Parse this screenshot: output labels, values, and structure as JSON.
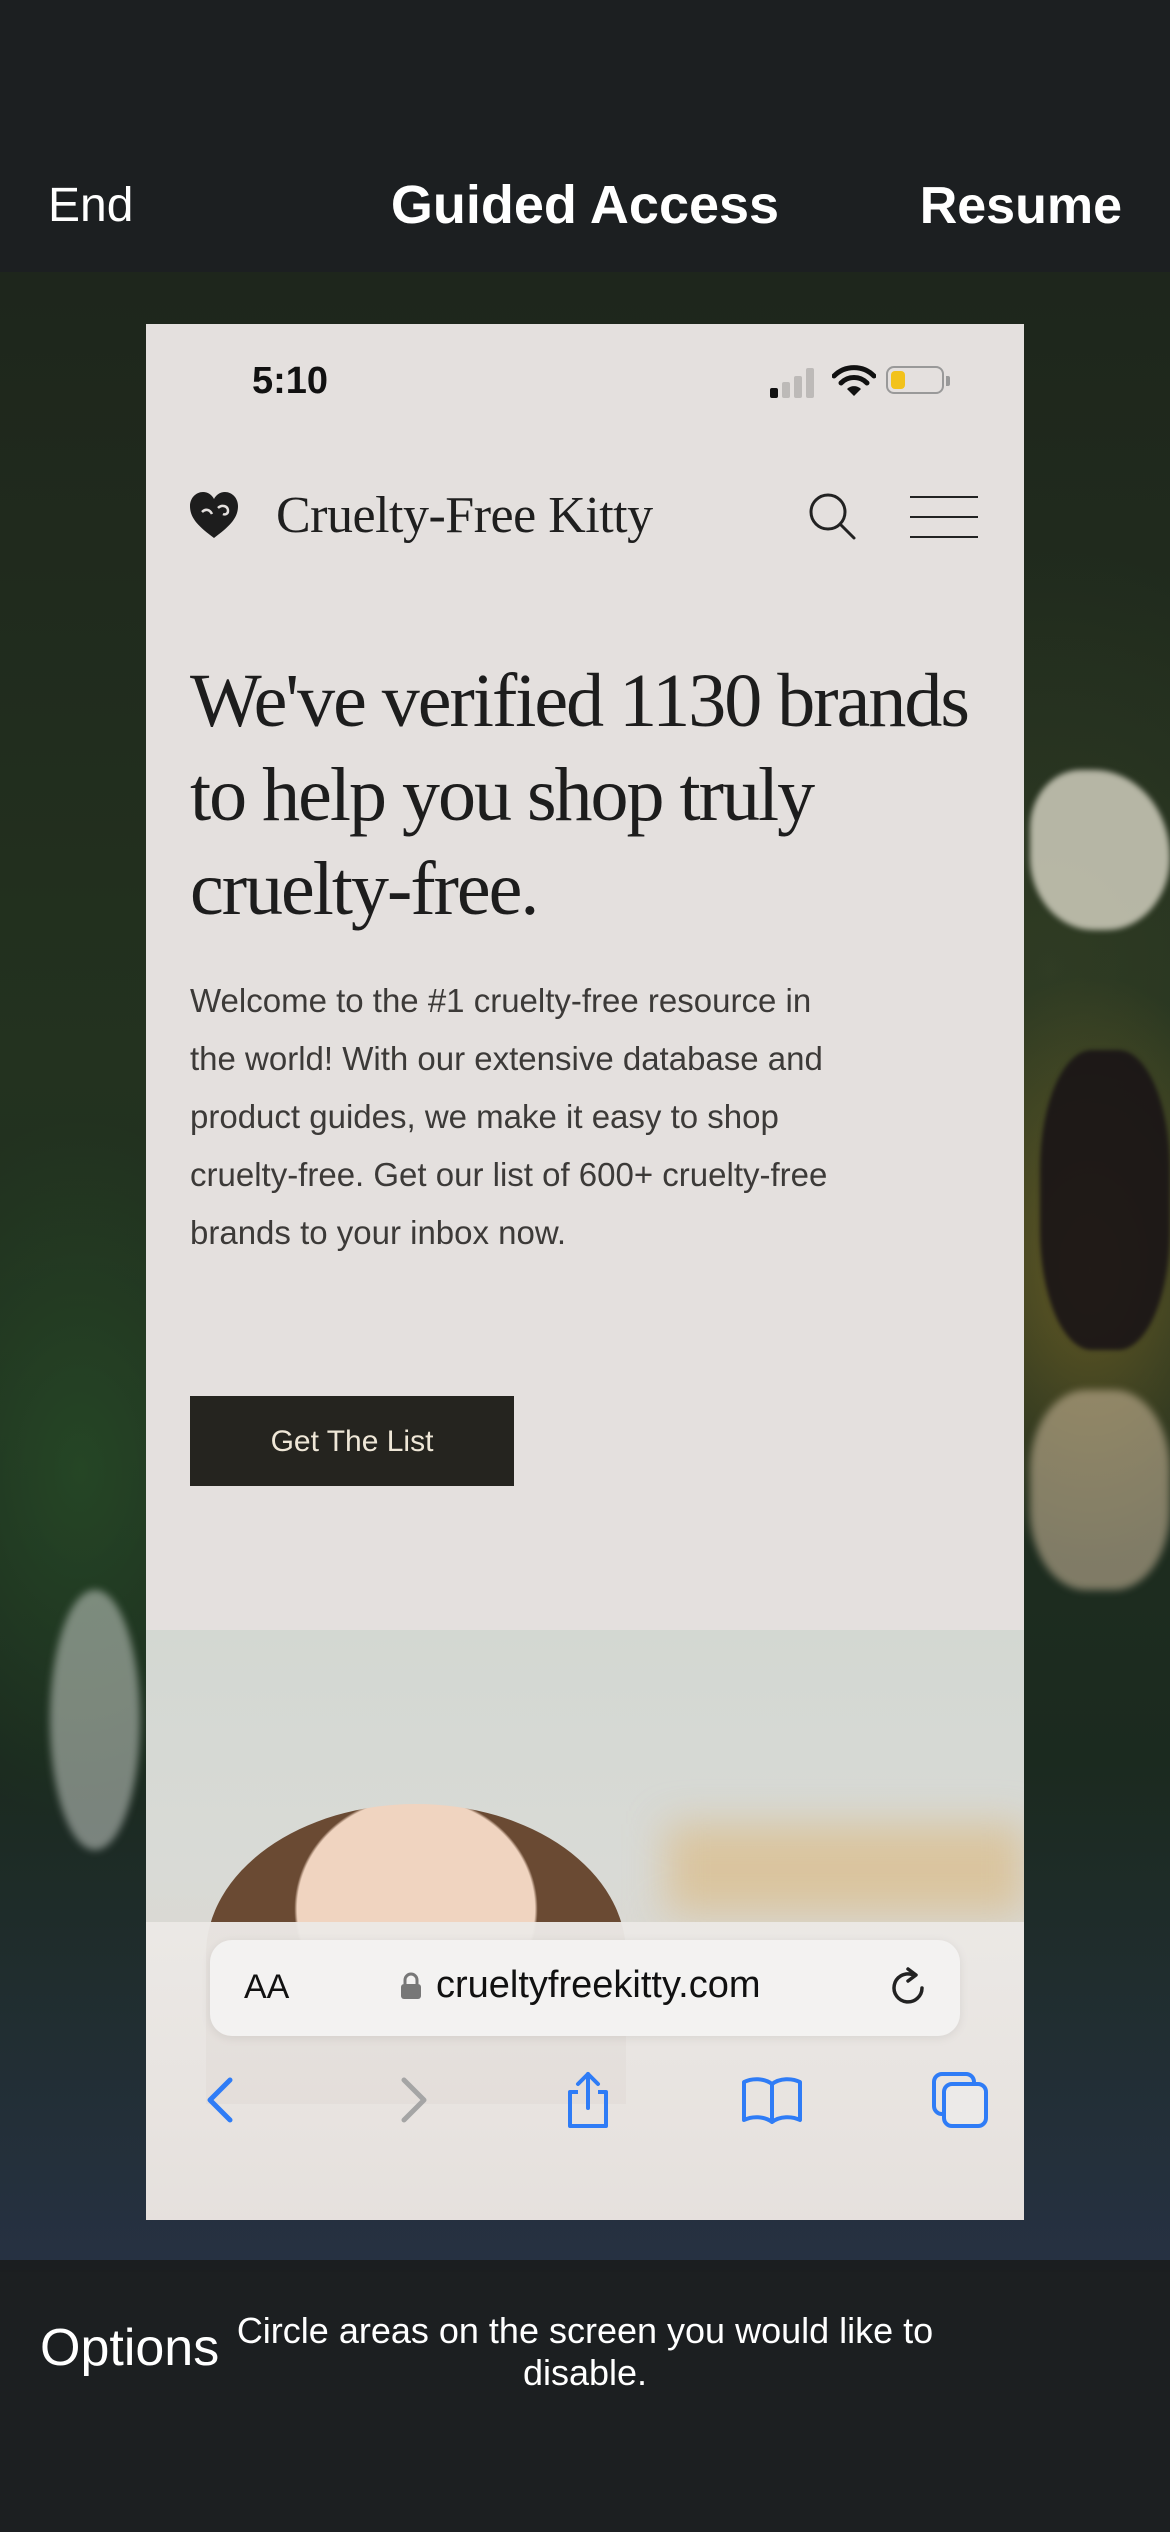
{
  "guided_access": {
    "end_label": "End",
    "title": "Guided Access",
    "resume_label": "Resume",
    "options_label": "Options",
    "hint": "Circle areas on the screen you would like to disable."
  },
  "status_bar": {
    "time": "5:10",
    "battery_color": "#f2c21b"
  },
  "site": {
    "logo_text": "Cruelty-Free Kitty",
    "hero_title": "We've verified 1130 brands to help you shop truly cruelty-free.",
    "hero_body": "Welcome to the #1 cruelty-free resource in the world! With our extensive database and product guides, we make it easy to shop cruelty-free. Get our list of 600+ cruelty-free brands to your inbox now.",
    "cta_label": "Get The List"
  },
  "safari": {
    "aa_label": "AA",
    "url": "crueltyfreekitty.com",
    "toolbar": [
      "back-icon",
      "forward-icon",
      "share-icon",
      "bookmarks-icon",
      "tabs-icon"
    ],
    "accent": "#2f7cf6"
  }
}
